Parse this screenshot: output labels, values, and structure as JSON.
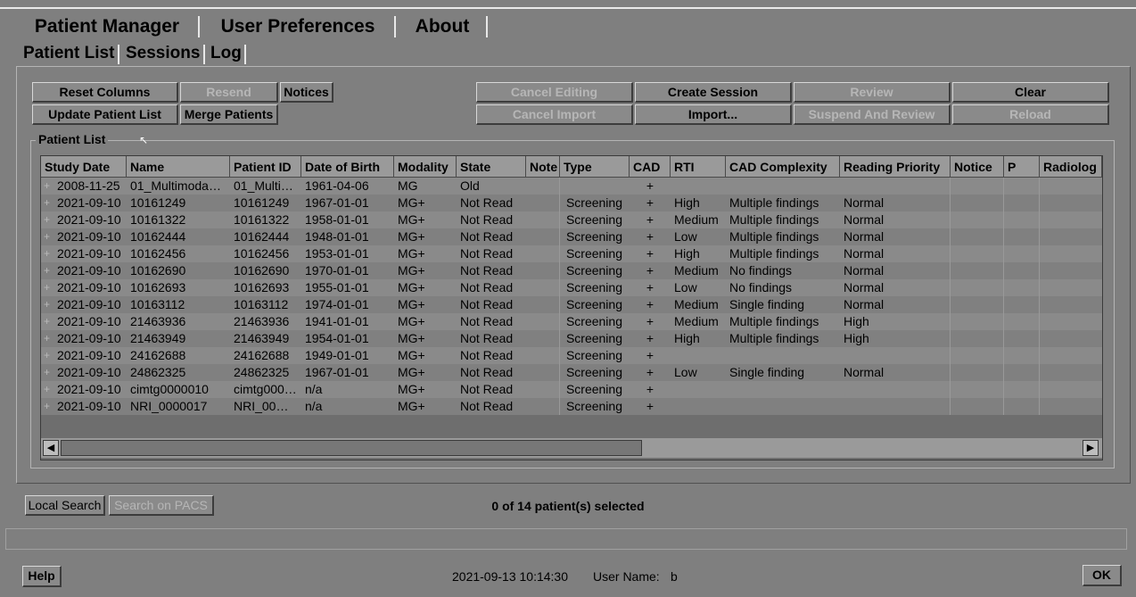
{
  "top_tabs": [
    "Patient Manager",
    "User Preferences",
    "About"
  ],
  "sub_tabs": [
    "Patient List",
    "Sessions",
    "Log"
  ],
  "buttons": {
    "reset_columns": "Reset Columns",
    "resend": "Resend",
    "notices": "Notices",
    "update_patient_list": "Update Patient List",
    "merge_patients": "Merge Patients",
    "cancel_editing": "Cancel Editing",
    "create_session": "Create Session",
    "review": "Review",
    "clear": "Clear",
    "cancel_import": "Cancel Import",
    "import": "Import...",
    "suspend_and_review": "Suspend And Review",
    "reload": "Reload",
    "local_search": "Local Search",
    "search_on_pacs": "Search on PACS",
    "help": "Help",
    "ok": "OK"
  },
  "patient_list": {
    "group_label": "Patient List",
    "columns": [
      "Study Date",
      "Name",
      "Patient ID",
      "Date of Birth",
      "Modality",
      "State",
      "Note",
      "Type",
      "CAD",
      "RTI",
      "CAD Complexity",
      "Reading Priority",
      "Notice",
      "P",
      "Radiolog"
    ],
    "rows": [
      [
        "2008-11-25",
        "01_Multimoda…",
        "01_Multi…",
        "1961-04-06",
        "MG",
        "Old",
        "",
        "",
        "+",
        "",
        "",
        "",
        "",
        "",
        ""
      ],
      [
        "2021-09-10",
        "10161249",
        "10161249",
        "1967-01-01",
        "MG+",
        "Not Read",
        "",
        "Screening",
        "+",
        "High",
        "Multiple findings",
        "Normal",
        "",
        "",
        ""
      ],
      [
        "2021-09-10",
        "10161322",
        "10161322",
        "1958-01-01",
        "MG+",
        "Not Read",
        "",
        "Screening",
        "+",
        "Medium",
        "Multiple findings",
        "Normal",
        "",
        "",
        ""
      ],
      [
        "2021-09-10",
        "10162444",
        "10162444",
        "1948-01-01",
        "MG+",
        "Not Read",
        "",
        "Screening",
        "+",
        "Low",
        "Multiple findings",
        "Normal",
        "",
        "",
        ""
      ],
      [
        "2021-09-10",
        "10162456",
        "10162456",
        "1953-01-01",
        "MG+",
        "Not Read",
        "",
        "Screening",
        "+",
        "High",
        "Multiple findings",
        "Normal",
        "",
        "",
        ""
      ],
      [
        "2021-09-10",
        "10162690",
        "10162690",
        "1970-01-01",
        "MG+",
        "Not Read",
        "",
        "Screening",
        "+",
        "Medium",
        "No findings",
        "Normal",
        "",
        "",
        ""
      ],
      [
        "2021-09-10",
        "10162693",
        "10162693",
        "1955-01-01",
        "MG+",
        "Not Read",
        "",
        "Screening",
        "+",
        "Low",
        "No findings",
        "Normal",
        "",
        "",
        ""
      ],
      [
        "2021-09-10",
        "10163112",
        "10163112",
        "1974-01-01",
        "MG+",
        "Not Read",
        "",
        "Screening",
        "+",
        "Medium",
        "Single finding",
        "Normal",
        "",
        "",
        ""
      ],
      [
        "2021-09-10",
        "21463936",
        "21463936",
        "1941-01-01",
        "MG+",
        "Not Read",
        "",
        "Screening",
        "+",
        "Medium",
        "Multiple findings",
        "High",
        "",
        "",
        ""
      ],
      [
        "2021-09-10",
        "21463949",
        "21463949",
        "1954-01-01",
        "MG+",
        "Not Read",
        "",
        "Screening",
        "+",
        "High",
        "Multiple findings",
        "High",
        "",
        "",
        ""
      ],
      [
        "2021-09-10",
        "24162688",
        "24162688",
        "1949-01-01",
        "MG+",
        "Not Read",
        "",
        "Screening",
        "+",
        "",
        "",
        "",
        "",
        "",
        ""
      ],
      [
        "2021-09-10",
        "24862325",
        "24862325",
        "1967-01-01",
        "MG+",
        "Not Read",
        "",
        "Screening",
        "+",
        "Low",
        "Single finding",
        "Normal",
        "",
        "",
        ""
      ],
      [
        "2021-09-10",
        "cimtg0000010",
        "cimtg000…",
        "n/a",
        "MG+",
        "Not Read",
        "",
        "Screening",
        "+",
        "",
        "",
        "",
        "",
        "",
        ""
      ],
      [
        "2021-09-10",
        "NRI_0000017",
        "NRI_00…",
        "n/a",
        "MG+",
        "Not Read",
        "",
        "Screening",
        "+",
        "",
        "",
        "",
        "",
        "",
        ""
      ]
    ]
  },
  "selection_status": "0 of 14 patient(s) selected",
  "footer": {
    "datetime": "2021-09-13  10:14:30",
    "user_label": "User Name:",
    "user_name": "b"
  }
}
